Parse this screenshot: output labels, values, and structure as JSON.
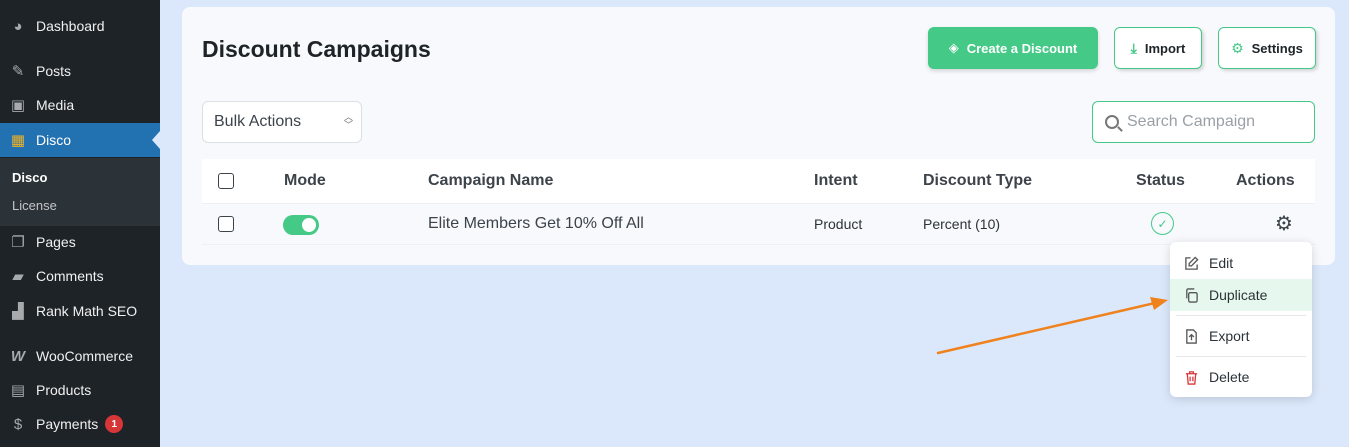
{
  "sidebar": {
    "items": [
      {
        "label": "Dashboard",
        "icon": "dashboard-icon"
      },
      {
        "label": "Posts",
        "icon": "pin-icon"
      },
      {
        "label": "Media",
        "icon": "media-icon"
      },
      {
        "label": "Disco",
        "icon": "disco-icon"
      },
      {
        "label": "Pages",
        "icon": "pages-icon"
      },
      {
        "label": "Comments",
        "icon": "comment-icon"
      },
      {
        "label": "Rank Math SEO",
        "icon": "rank-math-icon"
      },
      {
        "label": "WooCommerce",
        "icon": "woocommerce-icon"
      },
      {
        "label": "Products",
        "icon": "products-icon"
      },
      {
        "label": "Payments",
        "icon": "payments-icon",
        "badge": "1"
      }
    ],
    "submenu": [
      "Disco",
      "License"
    ],
    "accent": "#2271b1"
  },
  "header": {
    "title": "Discount Campaigns",
    "create_label": "Create a Discount",
    "import_label": "Import",
    "settings_label": "Settings"
  },
  "toolbar": {
    "bulk_label": "Bulk Actions",
    "search_placeholder": "Search Campaign"
  },
  "table": {
    "columns": [
      "Mode",
      "Campaign Name",
      "Intent",
      "Discount Type",
      "Status",
      "Actions"
    ],
    "rows": [
      {
        "mode": "on",
        "name": "Elite Members Get 10% Off All",
        "intent": "Product",
        "discount_type": "Percent (10)",
        "status": "active"
      }
    ]
  },
  "dropdown": {
    "items": [
      "Edit",
      "Duplicate",
      "Export",
      "Delete"
    ],
    "hovered": "Duplicate"
  },
  "colors": {
    "brand_green": "#45c987",
    "danger": "#d63638",
    "annotation_arrow": "#f0821e"
  }
}
